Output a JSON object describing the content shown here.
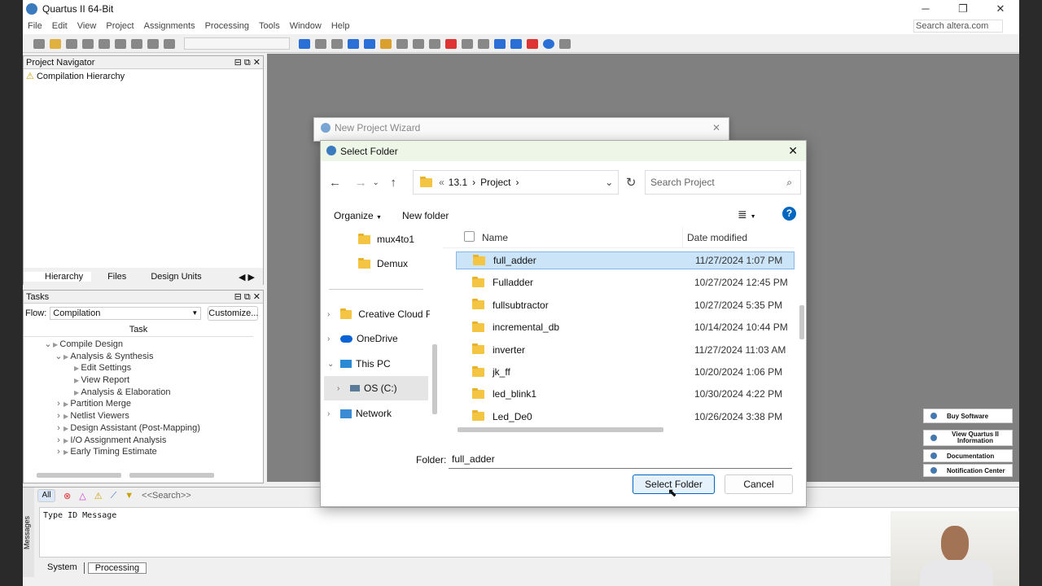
{
  "app": {
    "title": "Quartus II 64-Bit",
    "search_placeholder": "Search altera.com",
    "menu": [
      "File",
      "Edit",
      "View",
      "Project",
      "Assignments",
      "Processing",
      "Tools",
      "Window",
      "Help"
    ],
    "window_controls": {
      "minimize": "─",
      "restore": "❐",
      "close": "✕"
    }
  },
  "navigator": {
    "title": "Project Navigator",
    "root": "Compilation Hierarchy",
    "tabs": [
      "Hierarchy",
      "Files",
      "Design Units"
    ]
  },
  "tasks": {
    "title": "Tasks",
    "flow_label": "Flow:",
    "flow_value": "Compilation",
    "customize": "Customize...",
    "column": "Task",
    "items": [
      {
        "label": "Compile Design",
        "indent": 0,
        "arrow": "⌄"
      },
      {
        "label": "Analysis & Synthesis",
        "indent": 1,
        "arrow": "⌄"
      },
      {
        "label": "Edit Settings",
        "indent": 2,
        "arrow": ""
      },
      {
        "label": "View Report",
        "indent": 2,
        "arrow": ""
      },
      {
        "label": "Analysis & Elaboration",
        "indent": 2,
        "arrow": ""
      },
      {
        "label": "Partition Merge",
        "indent": 1,
        "arrow": "›"
      },
      {
        "label": "Netlist Viewers",
        "indent": 1,
        "arrow": "›"
      },
      {
        "label": "Design Assistant (Post-Mapping)",
        "indent": 1,
        "arrow": "›"
      },
      {
        "label": "I/O Assignment Analysis",
        "indent": 1,
        "arrow": "›"
      },
      {
        "label": "Early Timing Estimate",
        "indent": 1,
        "arrow": "›"
      }
    ]
  },
  "messages": {
    "filter_all": "All",
    "search_placeholder": "<<Search>>",
    "header": "Type  ID  Message",
    "side_label": "Messages",
    "tabs": [
      "System",
      "Processing"
    ]
  },
  "quick_links": [
    "Buy Software",
    "View Quartus II Information",
    "Documentation",
    "Notification Center"
  ],
  "wizard": {
    "title": "New Project Wizard"
  },
  "dialog": {
    "title": "Select Folder",
    "breadcrumb": [
      "«",
      "13.1",
      "›",
      "Project",
      "›"
    ],
    "search_placeholder": "Search Project",
    "organize": "Organize",
    "new_folder": "New folder",
    "col_name": "Name",
    "col_date": "Date modified",
    "nav_items": [
      "mux4to1",
      "Demux",
      "Creative Cloud F",
      "OneDrive",
      "This PC",
      "OS (C:)",
      "Network"
    ],
    "files": [
      {
        "name": "full_adder",
        "date": "11/27/2024 1:07 PM"
      },
      {
        "name": "Fulladder",
        "date": "10/27/2024 12:45 PM"
      },
      {
        "name": "fullsubtractor",
        "date": "10/27/2024 5:35 PM"
      },
      {
        "name": "incremental_db",
        "date": "10/14/2024 10:44 PM"
      },
      {
        "name": "inverter",
        "date": "11/27/2024 11:03 AM"
      },
      {
        "name": "jk_ff",
        "date": "10/20/2024 1:06 PM"
      },
      {
        "name": "led_blink1",
        "date": "10/30/2024 4:22 PM"
      },
      {
        "name": "Led_De0",
        "date": "10/26/2024 3:38 PM"
      }
    ],
    "folder_label": "Folder:",
    "folder_value": "full_adder",
    "select_button": "Select Folder",
    "cancel_button": "Cancel"
  },
  "colors": {
    "selection": "#cce4f7",
    "accent": "#0067c0",
    "canvas": "#808080"
  }
}
